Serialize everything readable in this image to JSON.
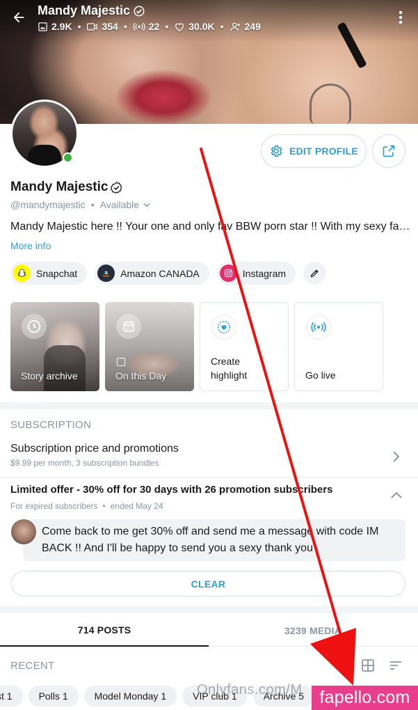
{
  "header": {
    "name": "Mandy Majestic",
    "stats": {
      "photos": "2.9K",
      "videos": "354",
      "streams": "22",
      "likes": "30.0K",
      "fans": "249"
    }
  },
  "profile": {
    "name": "Mandy Majestic",
    "handle": "@mandymajestic",
    "status": "Available",
    "bio": "Mandy Majestic here !! Your one and only fav BBW porn star !! With my sexy fat booty...",
    "more_info": "More info",
    "edit_profile_label": "EDIT PROFILE",
    "online": true
  },
  "links": [
    {
      "label": "Snapchat",
      "icon": "snapchat-icon",
      "color": "#fffc00"
    },
    {
      "label": "Amazon CANADA",
      "icon": "amazon-icon",
      "color": "#232f3e"
    },
    {
      "label": "Instagram",
      "icon": "instagram-icon",
      "color": "#e1306c"
    }
  ],
  "highlights": [
    {
      "label": "Story archive",
      "icon": "clock-icon"
    },
    {
      "label": "On this Day",
      "icon": "calendar-icon"
    },
    {
      "label": "Create highlight",
      "icon": "heart-plus-icon"
    },
    {
      "label": "Go live",
      "icon": "broadcast-icon"
    }
  ],
  "subscription": {
    "section_title": "SUBSCRIPTION",
    "row_title": "Subscription price and promotions",
    "row_subtitle": "$9.99 per month, 3 subscription bundles",
    "offer_title": "Limited offer - 30% off for 30 days with 26 promotion subscribers",
    "offer_audience": "For expired subscribers",
    "offer_ended": "ended May 24",
    "offer_message": "Come back to me get 30% off and send me a message with code IM BACK !! And I'll be happy to send you a sexy thank you",
    "clear_label": "CLEAR"
  },
  "tabs": [
    {
      "label": "714 POSTS",
      "active": true
    },
    {
      "label": "3239 MEDIA",
      "active": false
    }
  ],
  "feed": {
    "recent_label": "RECENT",
    "filters": [
      "st 1",
      "Polls 1",
      "Model Monday 1",
      "VIP club 1",
      "Archive 5"
    ]
  },
  "overlay": {
    "watermark": "Onlyfans.com/M",
    "brand": "fapello.com",
    "arrow_color": "#ee1111",
    "brand_color": "#e83e8c"
  },
  "colors": {
    "accent": "#2c9fd6",
    "muted": "#8a96a3",
    "online": "#3cb23c"
  }
}
